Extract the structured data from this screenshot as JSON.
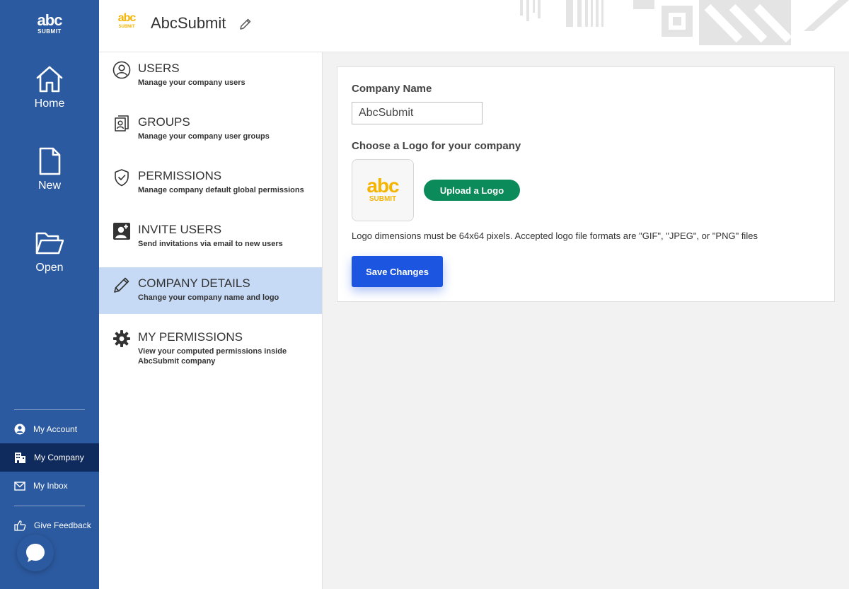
{
  "rail": {
    "logo_top": "abc",
    "logo_bottom": "SUBMIT",
    "nav": [
      {
        "label": "Home",
        "icon": "home-icon"
      },
      {
        "label": "New",
        "icon": "file-icon"
      },
      {
        "label": "Open",
        "icon": "folder-open-icon"
      }
    ],
    "links": [
      {
        "label": "My Account",
        "icon": "user-circle-icon",
        "active": false
      },
      {
        "label": "My Company",
        "icon": "building-icon",
        "active": true
      },
      {
        "label": "My Inbox",
        "icon": "envelope-icon",
        "active": false
      },
      {
        "label": "Give Feedback",
        "icon": "thumbs-up-icon",
        "active": false
      }
    ],
    "accent_color": "#2c5aa0",
    "active_color": "#0f2a5c"
  },
  "header": {
    "logo_top": "abc",
    "logo_bottom": "SUBMIT",
    "title": "AbcSubmit"
  },
  "menu": {
    "items": [
      {
        "title": "USERS",
        "desc": "Manage your company users",
        "icon": "user-circle-icon",
        "active": false
      },
      {
        "title": "GROUPS",
        "desc": "Manage your company user groups",
        "icon": "group-badge-icon",
        "active": false
      },
      {
        "title": "PERMISSIONS",
        "desc": "Manage company default global permissions",
        "icon": "shield-check-icon",
        "active": false
      },
      {
        "title": "INVITE USERS",
        "desc": "Send invitations via email to new users",
        "icon": "add-user-icon",
        "active": false
      },
      {
        "title": "COMPANY DETAILS",
        "desc": "Change your company name and logo",
        "icon": "pencil-icon",
        "active": true
      },
      {
        "title": "MY PERMISSIONS",
        "desc": "View your computed permissions inside AbcSubmit company",
        "icon": "gear-icon",
        "active": false
      }
    ],
    "active_bg": "#c6d9f5"
  },
  "company": {
    "name_label": "Company Name",
    "name_value": "AbcSubmit",
    "logo_label": "Choose a Logo for your company",
    "logo_top": "abc",
    "logo_bottom": "SUBMIT",
    "upload_label": "Upload a Logo",
    "hint": "Logo dimensions must be 64x64 pixels. Accepted logo file formats are \"GIF\", \"JPEG\", or \"PNG\" files",
    "save_label": "Save Changes",
    "brand_yellow": "#f5b400",
    "upload_color": "#0b8b5a",
    "save_color": "#1c55e0"
  }
}
